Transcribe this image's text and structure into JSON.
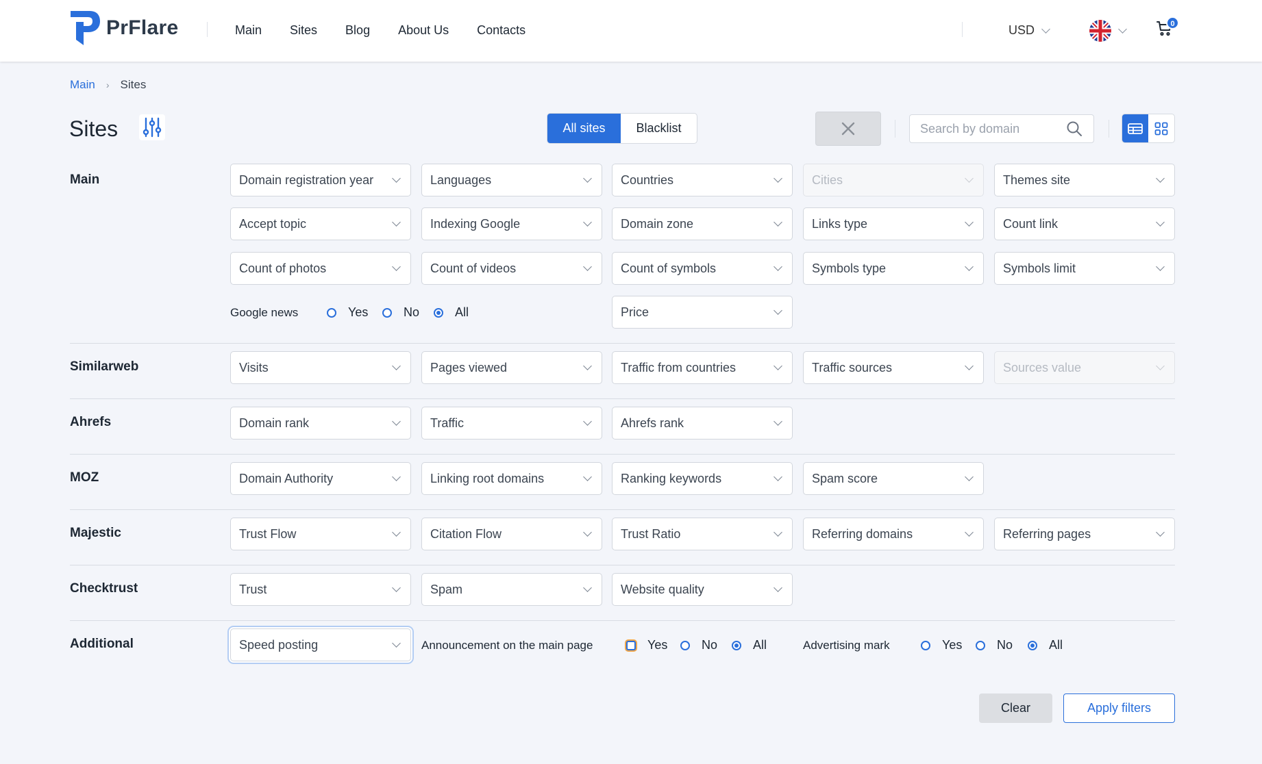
{
  "header": {
    "logo_text": "PrFlare",
    "nav": [
      "Main",
      "Sites",
      "Blog",
      "About Us",
      "Contacts"
    ],
    "currency": "USD",
    "cart_count": "0"
  },
  "breadcrumb": {
    "home": "Main",
    "current": "Sites"
  },
  "page": {
    "title": "Sites"
  },
  "tabs": {
    "all_sites": "All sites",
    "blacklist": "Blacklist"
  },
  "search": {
    "placeholder": "Search by domain"
  },
  "sections": {
    "main": {
      "label": "Main",
      "filters": [
        "Domain registration year",
        "Languages",
        "Countries",
        "Cities",
        "Themes site",
        "Accept topic",
        "Indexing Google",
        "Domain zone",
        "Links type",
        "Count link",
        "Count of photos",
        "Count of videos",
        "Count of symbols",
        "Symbols type",
        "Symbols limit"
      ],
      "google_news": {
        "label": "Google news",
        "yes": "Yes",
        "no": "No",
        "all": "All",
        "selected": "All"
      },
      "price": "Price"
    },
    "similarweb": {
      "label": "Similarweb",
      "filters": [
        "Visits",
        "Pages viewed",
        "Traffic from countries",
        "Traffic sources",
        "Sources value"
      ]
    },
    "ahrefs": {
      "label": "Ahrefs",
      "filters": [
        "Domain rank",
        "Traffic",
        "Ahrefs rank"
      ]
    },
    "moz": {
      "label": "MOZ",
      "filters": [
        "Domain Authority",
        "Linking root domains",
        "Ranking keywords",
        "Spam score"
      ]
    },
    "majestic": {
      "label": "Majestic",
      "filters": [
        "Trust Flow",
        "Citation Flow",
        "Trust Ratio",
        "Referring domains",
        "Referring pages"
      ]
    },
    "checktrust": {
      "label": "Checktrust",
      "filters": [
        "Trust",
        "Spam",
        "Website quality"
      ]
    },
    "additional": {
      "label": "Additional",
      "speed_posting": "Speed posting",
      "announcement": {
        "label": "Announcement on the main page",
        "yes": "Yes",
        "no": "No",
        "all": "All",
        "selected": "All"
      },
      "advertising": {
        "label": "Advertising mark",
        "yes": "Yes",
        "no": "No",
        "all": "All",
        "selected": "All"
      }
    }
  },
  "actions": {
    "clear": "Clear",
    "apply": "Apply filters"
  },
  "colors": {
    "accent": "#2a6fdb",
    "background": "#f3f5fa",
    "text": "#1d2733"
  }
}
